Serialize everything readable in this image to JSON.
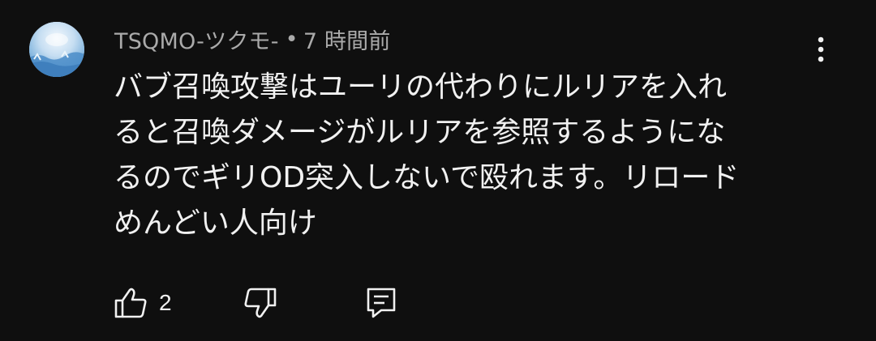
{
  "comment": {
    "author": "TSQMO-ツクモ-",
    "separator": "•",
    "time": "7 時間前",
    "text": "バブ召喚攻撃はユーリの代わりにルリアを入れ\nると召喚ダメージがルリアを参照するようにな\nるのでギリOD突入しないで殴れます。リロード\nめんどい人向け",
    "like_count": "2"
  },
  "icons": {
    "avatar": "avatar-image",
    "menu": "more-vert-icon",
    "like": "thumb-up-icon",
    "dislike": "thumb-down-icon",
    "reply": "reply-comment-icon"
  },
  "colors": {
    "background": "#0f0f0f",
    "text_primary": "#f1f1f1",
    "text_secondary": "#aaaaaa"
  }
}
